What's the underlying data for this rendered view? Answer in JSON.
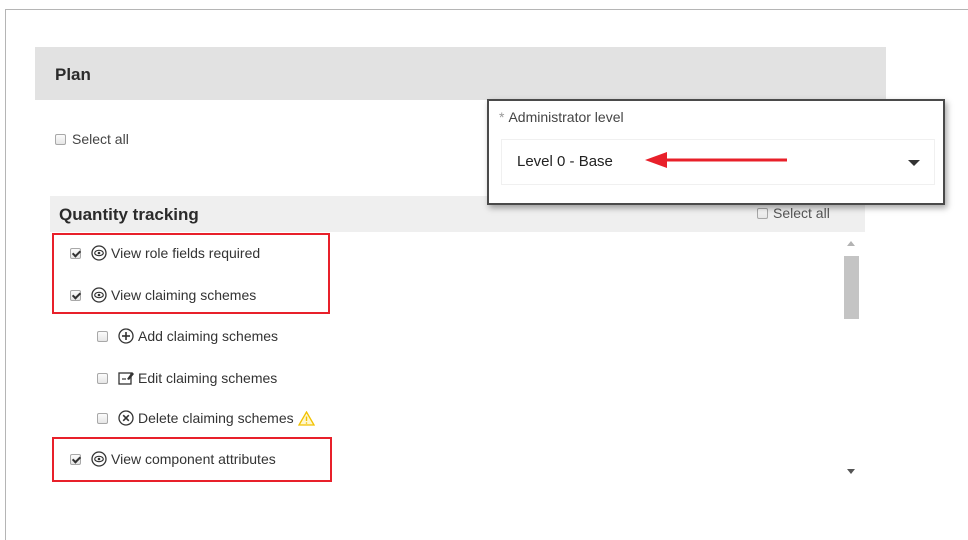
{
  "plan": {
    "title": "Plan",
    "select_all_label": "Select all"
  },
  "administrator": {
    "label": "Administrator level",
    "required_marker": "*",
    "selected_value": "Level 0 - Base"
  },
  "quantity_tracking": {
    "title": "Quantity tracking",
    "select_all_label": "Select all",
    "items": [
      {
        "label": "View role fields required",
        "checked": true,
        "icon": "view-icon"
      },
      {
        "label": "View claiming schemes",
        "checked": true,
        "icon": "view-icon"
      },
      {
        "label": "Add claiming schemes",
        "checked": false,
        "icon": "add-icon"
      },
      {
        "label": "Edit claiming schemes",
        "checked": false,
        "icon": "edit-icon"
      },
      {
        "label": "Delete claiming schemes",
        "checked": false,
        "icon": "delete-icon",
        "warning": true
      },
      {
        "label": "View component attributes",
        "checked": true,
        "icon": "view-icon"
      }
    ]
  },
  "colors": {
    "highlight": "#e8202a",
    "header_bg": "#e2e2e2",
    "warning": "#f2c200"
  }
}
